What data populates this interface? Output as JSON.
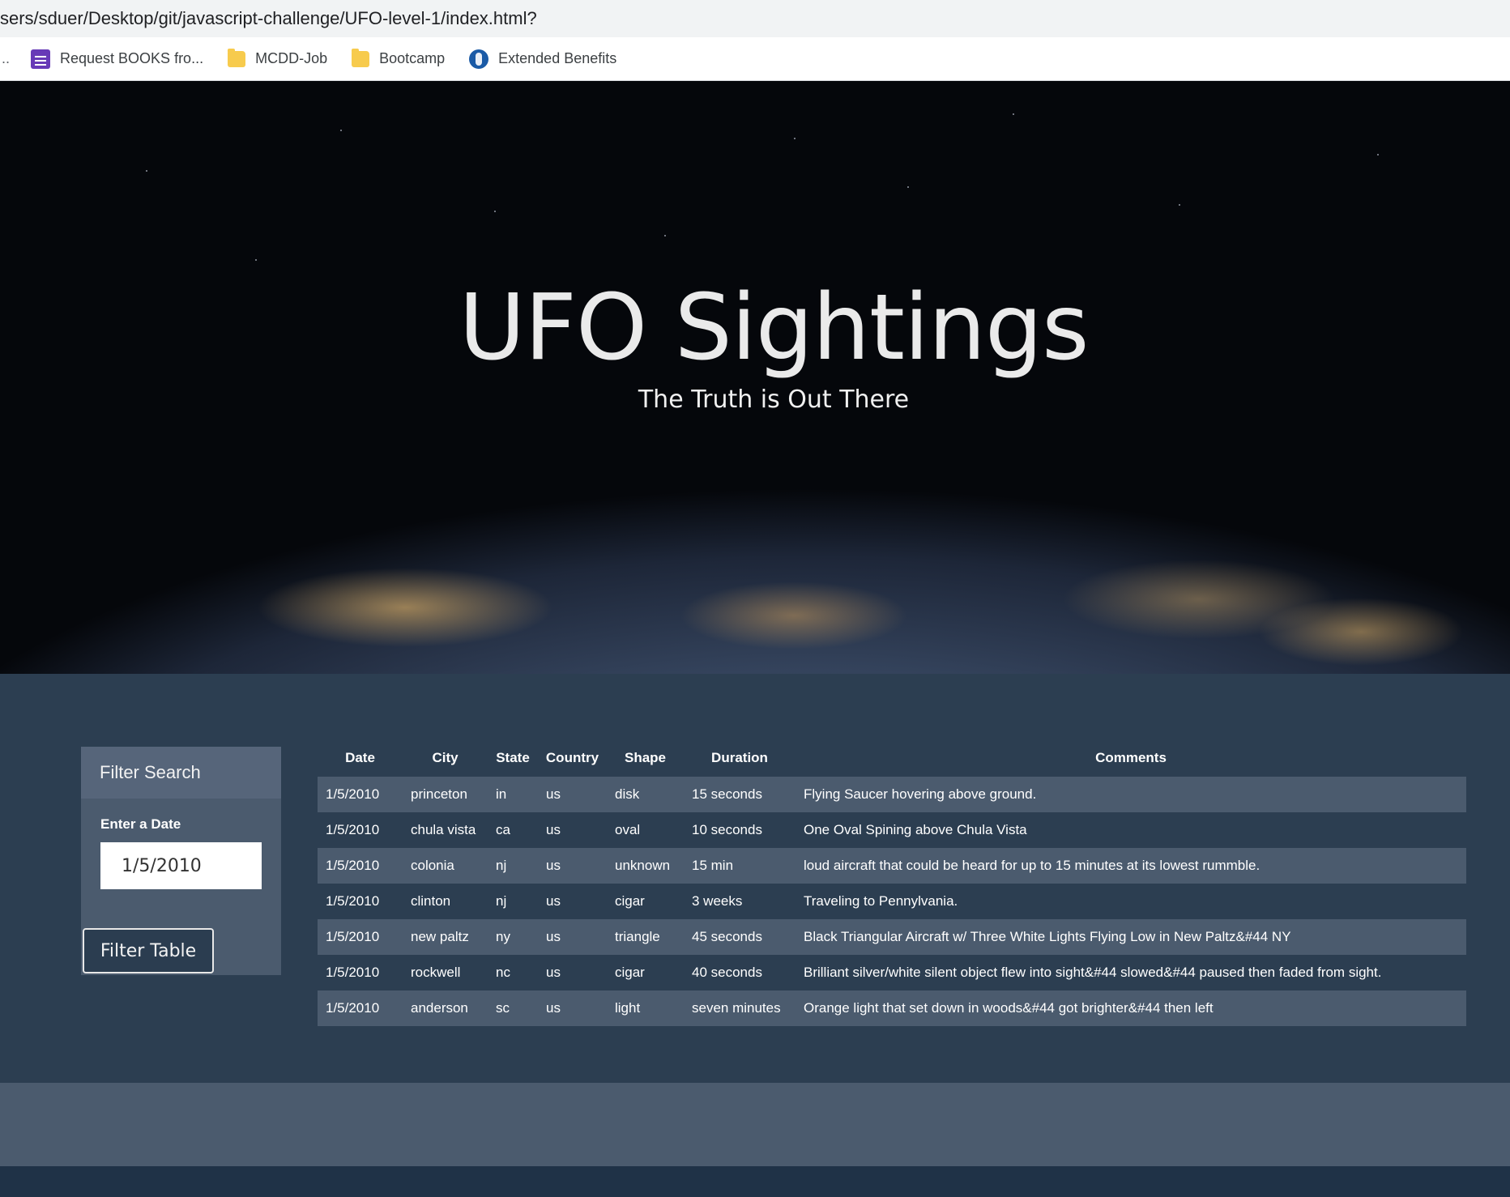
{
  "browser": {
    "url": "sers/sduer/Desktop/git/javascript-challenge/UFO-level-1/index.html?",
    "bookmarks": [
      {
        "label": "Request BOOKS fro...",
        "icon": "forms-icon"
      },
      {
        "label": "MCDD-Job",
        "icon": "folder-icon"
      },
      {
        "label": "Bootcamp",
        "icon": "folder-icon"
      },
      {
        "label": "Extended Benefits",
        "icon": "globe-icon"
      }
    ],
    "overflow": ".."
  },
  "hero": {
    "title": "UFO Sightings",
    "subtitle": "The Truth is Out There"
  },
  "filter": {
    "heading": "Filter Search",
    "date_label": "Enter a Date",
    "date_value": "1/5/2010",
    "button_label": "Filter Table"
  },
  "table": {
    "headers": [
      "Date",
      "City",
      "State",
      "Country",
      "Shape",
      "Duration",
      "Comments"
    ],
    "rows": [
      [
        "1/5/2010",
        "princeton",
        "in",
        "us",
        "disk",
        "15 seconds",
        "Flying Saucer hovering above ground."
      ],
      [
        "1/5/2010",
        "chula vista",
        "ca",
        "us",
        "oval",
        "10 seconds",
        "One Oval Spining above Chula Vista"
      ],
      [
        "1/5/2010",
        "colonia",
        "nj",
        "us",
        "unknown",
        "15 min",
        "loud aircraft that could be heard for up to 15 minutes at its lowest rummble."
      ],
      [
        "1/5/2010",
        "clinton",
        "nj",
        "us",
        "cigar",
        "3 weeks",
        "Traveling to Pennylvania."
      ],
      [
        "1/5/2010",
        "new paltz",
        "ny",
        "us",
        "triangle",
        "45 seconds",
        "Black Triangular Aircraft w/ Three White Lights Flying Low in New Paltz&#44 NY"
      ],
      [
        "1/5/2010",
        "rockwell",
        "nc",
        "us",
        "cigar",
        "40 seconds",
        "Brilliant silver/white silent object flew into sight&#44 slowed&#44 paused then faded from sight."
      ],
      [
        "1/5/2010",
        "anderson",
        "sc",
        "us",
        "light",
        "seven minutes",
        "Orange light that set down in woods&#44 got brighter&#44 then left"
      ]
    ]
  }
}
